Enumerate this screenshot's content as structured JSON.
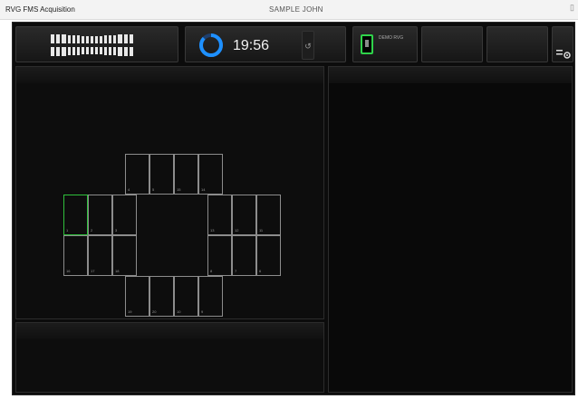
{
  "window": {
    "title": "RVG FMS Acquisition",
    "patient": "SAMPLE JOHN",
    "control_glyph": "▯"
  },
  "toolbar": {
    "timer": "19:56",
    "reset_glyph": "↺",
    "sensor_label": "DEMO RVG"
  },
  "fms_layout": {
    "top_row": [
      "4",
      "5",
      "15",
      "14"
    ],
    "left_upper": [
      "1",
      "2",
      "3"
    ],
    "right_upper": [
      "13",
      "12",
      "11"
    ],
    "left_lower": [
      "16",
      "17",
      "18"
    ],
    "right_lower": [
      "8",
      "7",
      "6"
    ],
    "bottom_row": [
      "19",
      "20",
      "10",
      "9"
    ],
    "selected": "1"
  },
  "colors": {
    "accent_ring": "#1e90ff",
    "sensor_green": "#2fd34a",
    "selected_cell": "#2fbf3c"
  }
}
